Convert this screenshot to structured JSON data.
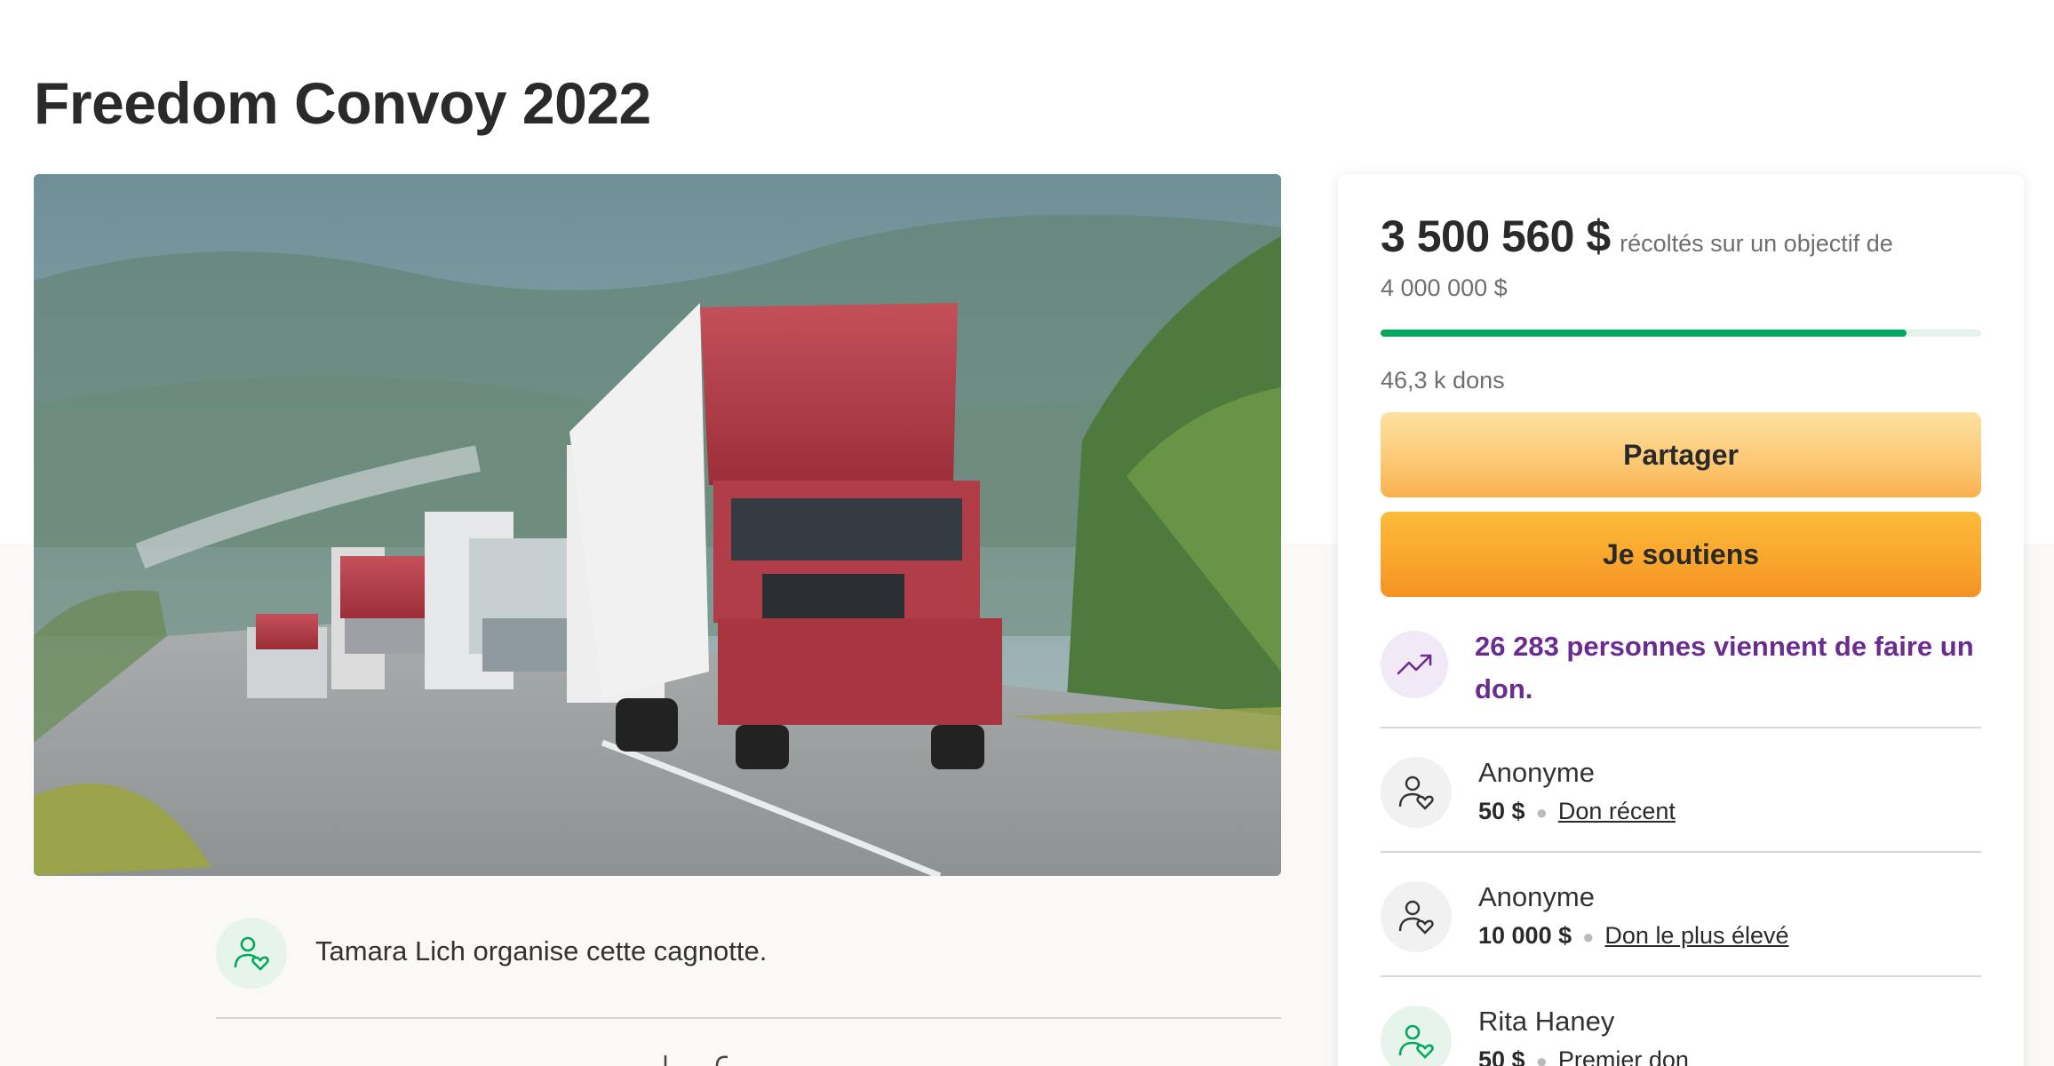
{
  "page": {
    "title": "Freedom Convoy 2022"
  },
  "hero": {
    "icon": "convoy-photo"
  },
  "organizer": {
    "text": "Tamara Lich organise cette cagnotte.",
    "icon": "person-heart-icon"
  },
  "summary": {
    "raised": "3 500 560 $",
    "raised_text": "récoltés sur un objectif de",
    "goal": "4 000 000 $",
    "progress_fraction": 0.875,
    "donations_count": "46,3 k dons",
    "colors": {
      "progress": "#02a95c",
      "trend": "#6a2c91"
    }
  },
  "buttons": {
    "share": "Partager",
    "donate": "Je soutiens"
  },
  "trend": {
    "text": "26 283 personnes viennent de faire un don.",
    "icon": "trending-up-icon"
  },
  "donors": [
    {
      "name": "Anonyme",
      "amount": "50 $",
      "label": "Don récent"
    },
    {
      "name": "Anonyme",
      "amount": "10 000 $",
      "label": "Don le plus élevé"
    },
    {
      "name": "Rita Haney",
      "amount": "50 $",
      "label": "Premier don"
    }
  ]
}
